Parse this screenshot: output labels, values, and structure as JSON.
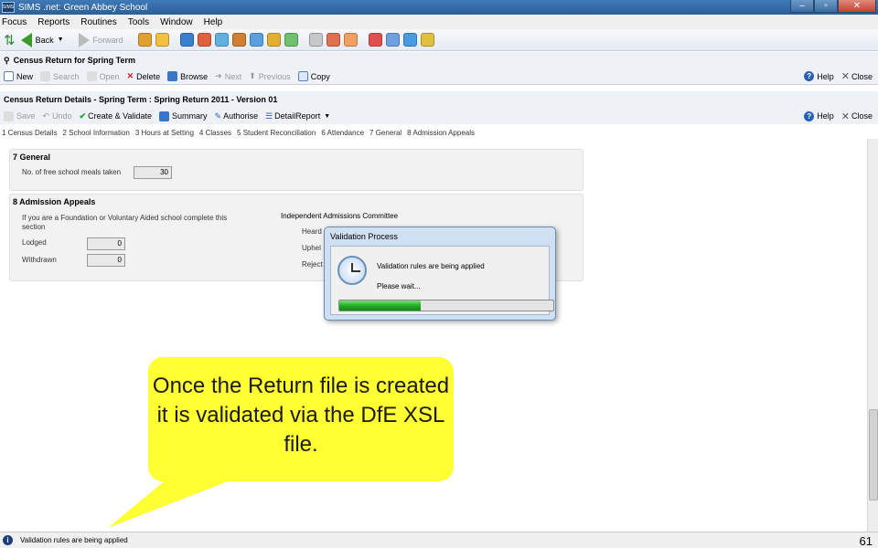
{
  "window": {
    "app_badge": "SIMS",
    "title": "SIMS .net: Green Abbey School",
    "controls": [
      "–",
      "▫",
      "✕"
    ]
  },
  "menu": [
    "Focus",
    "Reports",
    "Routines",
    "Tools",
    "Window",
    "Help"
  ],
  "nav": {
    "back": "Back",
    "forward": "Forward"
  },
  "quick_icon_colors": [
    "#e0a030",
    "#f0c040",
    "#3a7fd0",
    "#e06040",
    "#60b0e0",
    "#d08030",
    "#5aa0e0",
    "#e0b030",
    "#70c070",
    "#c8c8c8",
    "#e07050",
    "#f0a060",
    "#e05050",
    "#70a0e0",
    "#4a9ae0",
    "#e0c040"
  ],
  "outer_panel": {
    "title": "Census Return for Spring Term",
    "actions": [
      "New",
      "Search",
      "Open",
      "Delete",
      "Browse",
      "Next",
      "Previous",
      "Copy"
    ],
    "disabled": [
      "Search",
      "Open",
      "Next",
      "Previous"
    ],
    "help": "Help",
    "close": "Close"
  },
  "inner_panel": {
    "title": "Census Return Details - Spring Term : Spring Return 2011 - Version 01",
    "actions": [
      "Save",
      "Undo",
      "Create & Validate",
      "Summary",
      "Authorise",
      "DetailReport"
    ],
    "disabled": [
      "Save",
      "Undo"
    ],
    "help": "Help",
    "close": "Close"
  },
  "tabs": [
    "1 Census Details",
    "2 School Information",
    "3 Hours at Setting",
    "4 Classes",
    "5 Student Reconciliation",
    "6 Attendance",
    "7 General",
    "8 Admission Appeals"
  ],
  "general": {
    "title": "7 General",
    "fsm_label": "No. of free school meals taken",
    "fsm_value": "30"
  },
  "appeals": {
    "title": "8 Admission Appeals",
    "note": "If you are a Foundation or Voluntary Aided school complete this section",
    "lodged_label": "Lodged",
    "lodged_value": "0",
    "withdrawn_label": "Withdrawn",
    "withdrawn_value": "0",
    "committee_title": "Independent Admissions Committee",
    "heard_label": "Heard",
    "upheld_label": "Uphel",
    "rejected_label": "Reject"
  },
  "dialog": {
    "title": "Validation Process",
    "message": "Validation rules are being applied",
    "wait": "Please wait...",
    "progress": 0.38
  },
  "callout": {
    "text": "Once the Return file is created it is validated via the DfE XSL file."
  },
  "status": {
    "icon": "i",
    "text": "Validation rules are being applied"
  },
  "slide_number": "61"
}
